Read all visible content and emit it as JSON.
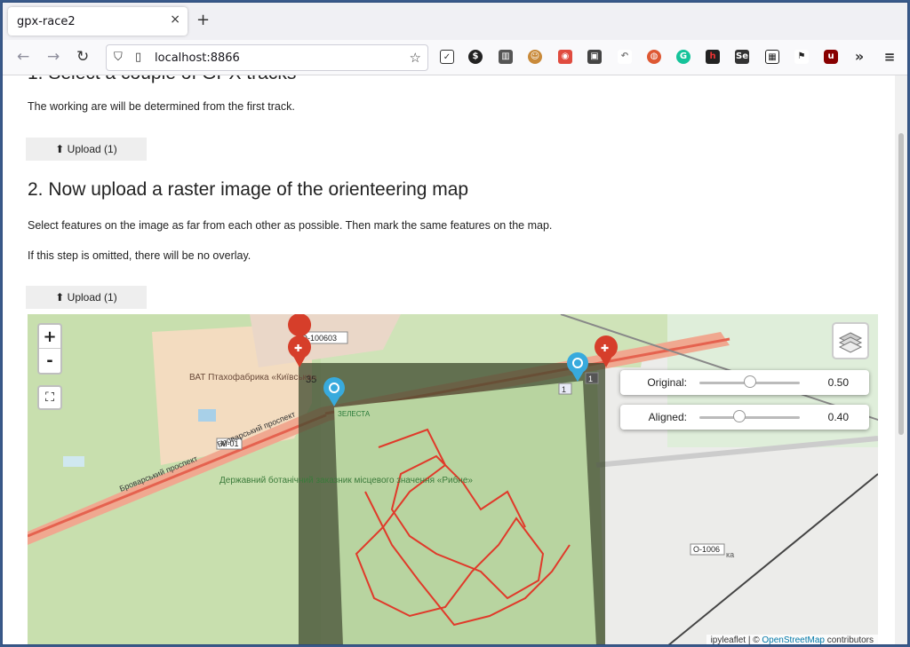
{
  "browser": {
    "tab_title": "gpx-race2",
    "tab_close": "×",
    "new_tab": "+",
    "url": "localhost:8866"
  },
  "page": {
    "step1_heading_partial": "1. Select a couple of GPX tracks",
    "step1_text": "The working are will be determined from the first track.",
    "upload1_label": "Upload (1)",
    "step2_heading": "2. Now upload a raster image of the orienteering map",
    "step2_text1": "Select features on the image as far from each other as possible. Then mark the same features on the map.",
    "step2_text2": "If this step is omitted, there will be no overlay.",
    "upload2_label": "Upload (1)"
  },
  "map": {
    "zoom_in": "+",
    "zoom_out": "-",
    "fullscreen": "⛶",
    "sliders": [
      {
        "label": "Original:",
        "value": "0.50",
        "fraction": 0.5
      },
      {
        "label": "Aligned:",
        "value": "0.40",
        "fraction": 0.4
      }
    ],
    "attribution_prefix": "ipyleaflet | ©",
    "attribution_link": "OpenStreetMap",
    "attribution_suffix": "contributors",
    "labels": {
      "road1": "O-100603",
      "factory": "ВАТ Птахофабрика «Київська»",
      "road2": "M-01",
      "street": "Броварський проспект",
      "street2": "Броварський проспект",
      "reserve": "Державний ботанічний заказник місцевого значення «Рибне»",
      "road3": "O-1006",
      "road3_suffix": "ка",
      "overlay_label1": "35",
      "overlay_label2": "ЗЕЛЕСТА",
      "box1": "1",
      "box2": "1"
    }
  }
}
